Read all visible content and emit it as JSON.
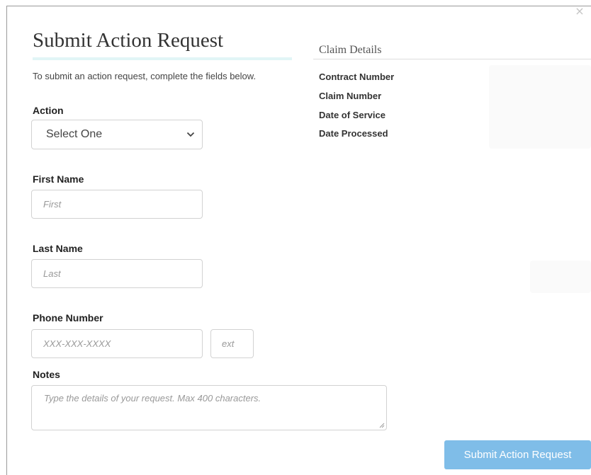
{
  "modal": {
    "close_glyph": "×",
    "title": "Submit Action Request",
    "intro": "To submit an action request, complete the fields below."
  },
  "form": {
    "action": {
      "label": "Action",
      "selected": "Select One"
    },
    "first_name": {
      "label": "First Name",
      "placeholder": "First",
      "value": ""
    },
    "last_name": {
      "label": "Last Name",
      "placeholder": "Last",
      "value": ""
    },
    "phone": {
      "label": "Phone Number",
      "placeholder": "XXX-XXX-XXXX",
      "ext_placeholder": "ext",
      "value": "",
      "ext_value": ""
    },
    "notes": {
      "label": "Notes",
      "placeholder": "Type the details of your request. Max 400 characters.",
      "value": ""
    }
  },
  "claim_details": {
    "heading": "Claim Details",
    "fields": {
      "contract_number": "Contract Number",
      "claim_number": "Claim Number",
      "date_of_service": "Date of Service",
      "date_processed": "Date Processed"
    }
  },
  "actions": {
    "submit_label": "Submit Action Request"
  },
  "colors": {
    "submit_button": "#7fbde8",
    "title_underline": "#e1f5f6",
    "input_border": "#d2d2d2",
    "placeholder_text": "#999999"
  }
}
